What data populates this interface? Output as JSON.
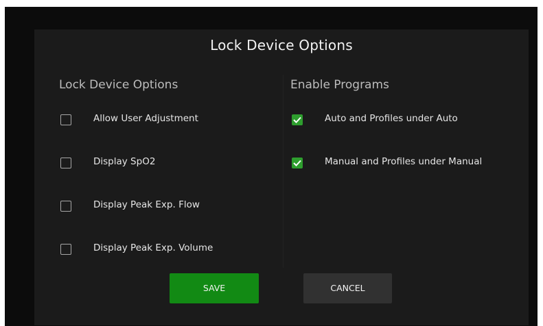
{
  "dialog": {
    "title": "Lock Device Options"
  },
  "lock_device_options": {
    "heading": "Lock Device Options",
    "items": [
      {
        "label": "Allow User Adjustment",
        "checked": false
      },
      {
        "label": "Display SpO2",
        "checked": false
      },
      {
        "label": "Display Peak Exp. Flow",
        "checked": false
      },
      {
        "label": "Display Peak Exp. Volume",
        "checked": false
      }
    ]
  },
  "enable_programs": {
    "heading": "Enable Programs",
    "items": [
      {
        "label": "Auto and Profiles under Auto",
        "checked": true
      },
      {
        "label": "Manual and Profiles under Manual",
        "checked": true
      }
    ]
  },
  "buttons": {
    "save_label": "SAVE",
    "cancel_label": "CANCEL"
  },
  "colors": {
    "save_button": "#128a14",
    "cancel_button": "#313131",
    "checkbox_checked": "#2e9e2e",
    "dialog_background": "#1b1b1b"
  }
}
